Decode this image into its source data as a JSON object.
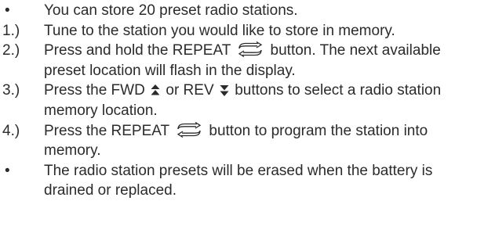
{
  "instructions": {
    "intro_bullet": "You can store 20 preset radio stations.",
    "steps": [
      {
        "marker": "1.)",
        "line1": "Tune to the station you would like to store in memory."
      },
      {
        "marker": "2.)",
        "pre": "Press and hold the REPEAT",
        "post": "button.  The next available",
        "line2": "preset location will flash in the display."
      },
      {
        "marker": "3.)",
        "pre": "Press the FWD",
        "mid": "or REV",
        "post": "buttons to select a radio station",
        "line2": "memory location."
      },
      {
        "marker": "4.)",
        "pre": "Press the REPEAT",
        "post": "button to program the station into",
        "line2": "memory."
      }
    ],
    "outro_bullet_line1": "The radio station presets will be erased when the battery is",
    "outro_bullet_line2": "drained or replaced.",
    "bullet_symbol": "•"
  },
  "icons": {
    "repeat": "repeat-icon",
    "fwd": "fwd-arrow-up-icon",
    "rev": "rev-arrow-down-icon"
  },
  "colors": {
    "text": "#2b2b2b"
  }
}
